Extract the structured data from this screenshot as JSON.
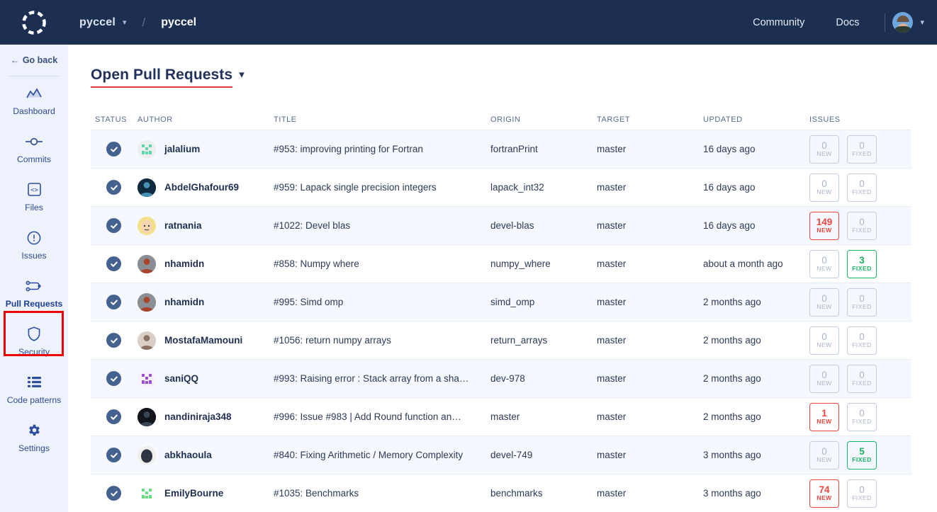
{
  "topbar": {
    "logo_icon": "codacy-dashed-circle-logo",
    "org_name": "pyccel",
    "org_caret_icon": "chevron-down-icon",
    "separator": "/",
    "repo_name": "pyccel",
    "nav": [
      {
        "label": "Community",
        "name": "community"
      },
      {
        "label": "Docs",
        "name": "docs"
      }
    ],
    "avatar_icon": "user-avatar",
    "avatar_caret_icon": "chevron-down-icon"
  },
  "sidebar": {
    "go_back": "Go back",
    "go_back_icon": "arrow-left-icon",
    "highlight_color": "#ee0000",
    "items": [
      {
        "label": "Dashboard",
        "icon": "chart-area-icon",
        "active": false
      },
      {
        "label": "Commits",
        "icon": "commit-node-icon",
        "active": false
      },
      {
        "label": "Files",
        "icon": "code-file-icon",
        "active": false
      },
      {
        "label": "Issues",
        "icon": "exclamation-circle-icon",
        "active": false
      },
      {
        "label": "Pull Requests",
        "icon": "pull-request-icon",
        "active": true
      },
      {
        "label": "Security",
        "icon": "shield-icon",
        "active": false
      },
      {
        "label": "Code patterns",
        "icon": "list-icon",
        "active": false
      },
      {
        "label": "Settings",
        "icon": "gear-icon",
        "active": false
      }
    ]
  },
  "main": {
    "page_title": "Open Pull Requests",
    "page_title_caret_icon": "chevron-down-icon",
    "title_underline_color": "#e23a3a",
    "columns": [
      "STATUS",
      "AUTHOR",
      "TITLE",
      "ORIGIN",
      "TARGET",
      "UPDATED",
      "ISSUES"
    ],
    "badge_captions": {
      "new": "NEW",
      "fixed": "FIXED"
    },
    "status_icon": "check-circle-icon",
    "rows": [
      {
        "author": "jalalium",
        "title": "#953: improving printing for Fortran",
        "origin": "fortranPrint",
        "target": "master",
        "updated": "16 days ago",
        "new": "0",
        "fixed": "0",
        "avatar_bg": "#eceef0",
        "avatar_fg": "#5ed6ae",
        "avatar_style": "pixel"
      },
      {
        "author": "AbdelGhafour69",
        "title": "#959: Lapack single precision integers",
        "origin": "lapack_int32",
        "target": "master",
        "updated": "16 days ago",
        "new": "0",
        "fixed": "0",
        "avatar_bg": "#0f2b3d",
        "avatar_fg": "#4a8fb5",
        "avatar_style": "photo"
      },
      {
        "author": "ratnania",
        "title": "#1022: Devel blas",
        "origin": "devel-blas",
        "target": "master",
        "updated": "16 days ago",
        "new": "149",
        "fixed": "0",
        "avatar_bg": "#f2e08a",
        "avatar_fg": "#f6d6b0",
        "avatar_style": "face"
      },
      {
        "author": "nhamidn",
        "title": "#858: Numpy where",
        "origin": "numpy_where",
        "target": "master",
        "updated": "about a month ago",
        "new": "0",
        "fixed": "3",
        "avatar_bg": "#8b8f94",
        "avatar_fg": "#a8442c",
        "avatar_style": "photo"
      },
      {
        "author": "nhamidn",
        "title": "#995: Simd omp",
        "origin": "simd_omp",
        "target": "master",
        "updated": "2 months ago",
        "new": "0",
        "fixed": "0",
        "avatar_bg": "#8b8f94",
        "avatar_fg": "#a8442c",
        "avatar_style": "photo"
      },
      {
        "author": "MostafaMamouni",
        "title": "#1056: return numpy arrays",
        "origin": "return_arrays",
        "target": "master",
        "updated": "2 months ago",
        "new": "0",
        "fixed": "0",
        "avatar_bg": "#d9cfc6",
        "avatar_fg": "#8a7363",
        "avatar_style": "photo"
      },
      {
        "author": "saniQQ",
        "title": "#993: Raising error : Stack array from a sha…",
        "origin": "dev-978",
        "target": "master",
        "updated": "2 months ago",
        "new": "0",
        "fixed": "0",
        "avatar_bg": "#f6f1fb",
        "avatar_fg": "#9b4fd1",
        "avatar_style": "pixel"
      },
      {
        "author": "nandiniraja348",
        "title": "#996: Issue #983 | Add Round function an…",
        "origin": "master",
        "target": "master",
        "updated": "2 months ago",
        "new": "1",
        "fixed": "0",
        "avatar_bg": "#12161c",
        "avatar_fg": "#3a4656",
        "avatar_style": "photo"
      },
      {
        "author": "abkhaoula",
        "title": "#840: Fixing Arithmetic / Memory Complexity",
        "origin": "devel-749",
        "target": "master",
        "updated": "3 months ago",
        "new": "0",
        "fixed": "5",
        "avatar_bg": "#efefec",
        "avatar_fg": "#2b3340",
        "avatar_style": "face"
      },
      {
        "author": "EmilyBourne",
        "title": "#1035: Benchmarks",
        "origin": "benchmarks",
        "target": "master",
        "updated": "3 months ago",
        "new": "74",
        "fixed": "0",
        "avatar_bg": "#ffffff",
        "avatar_fg": "#66dd7f",
        "avatar_style": "pixel"
      }
    ]
  }
}
